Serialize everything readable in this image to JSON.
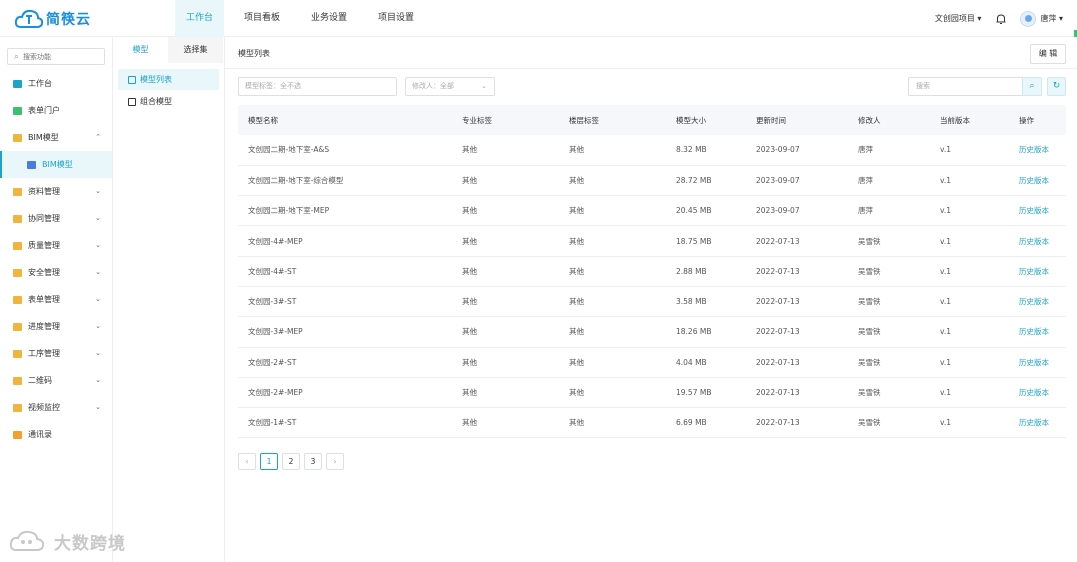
{
  "app": {
    "name": "简筷云"
  },
  "topnav": [
    {
      "label": "工作台",
      "active": true
    },
    {
      "label": "项目看板",
      "active": false
    },
    {
      "label": "业务设置",
      "active": false
    },
    {
      "label": "项目设置",
      "active": false
    }
  ],
  "header": {
    "project": "文创园项目 ▾",
    "user": "唐萍 ▾"
  },
  "sidebar": {
    "search_placeholder": "搜索功能",
    "items": [
      {
        "label": "工作台",
        "icon": "dashboard-icon"
      },
      {
        "label": "表单门户",
        "icon": "form-portal-icon"
      },
      {
        "label": "BIM模型",
        "icon": "folder-icon",
        "chev": "⌃"
      },
      {
        "label": "BIM模型",
        "icon": "bim-icon"
      },
      {
        "label": "资料管理",
        "icon": "folder-icon",
        "chev": "⌄"
      },
      {
        "label": "协同管理",
        "icon": "folder-icon",
        "chev": "⌄"
      },
      {
        "label": "质量管理",
        "icon": "folder-icon",
        "chev": "⌄"
      },
      {
        "label": "安全管理",
        "icon": "folder-icon",
        "chev": "⌄"
      },
      {
        "label": "表单管理",
        "icon": "folder-icon",
        "chev": "⌄"
      },
      {
        "label": "进度管理",
        "icon": "folder-icon",
        "chev": "⌄"
      },
      {
        "label": "工序管理",
        "icon": "folder-icon",
        "chev": "⌄"
      },
      {
        "label": "二维码",
        "icon": "folder-icon",
        "chev": "⌄"
      },
      {
        "label": "视频监控",
        "icon": "folder-icon",
        "chev": "⌄"
      },
      {
        "label": "通讯录",
        "icon": "contacts-icon"
      }
    ]
  },
  "subpanel": {
    "tabs": [
      "模型",
      "选择集"
    ],
    "items": [
      "模型列表",
      "组合模型"
    ]
  },
  "main": {
    "title": "模型列表",
    "edit_label": "编 辑",
    "filter_tag": "模型标签：全不选",
    "filter_modifier": "修改人：全部",
    "search_placeholder": "搜索",
    "columns": [
      "模型名称",
      "专业标签",
      "楼层标签",
      "模型大小",
      "更新时间",
      "修改人",
      "当前版本",
      "操作"
    ],
    "rows": [
      [
        "文创园二期-地下室-A&S",
        "其他",
        "其他",
        "8.32 MB",
        "2023-09-07",
        "唐萍",
        "v.1",
        "历史版本"
      ],
      [
        "文创园二期-地下室-综合模型",
        "其他",
        "其他",
        "28.72 MB",
        "2023-09-07",
        "唐萍",
        "v.1",
        "历史版本"
      ],
      [
        "文创园二期-地下室-MEP",
        "其他",
        "其他",
        "20.45 MB",
        "2023-09-07",
        "唐萍",
        "v.1",
        "历史版本"
      ],
      [
        "文创园-4#-MEP",
        "其他",
        "其他",
        "18.75 MB",
        "2022-07-13",
        "吴雪铁",
        "v.1",
        "历史版本"
      ],
      [
        "文创园-4#-ST",
        "其他",
        "其他",
        "2.88 MB",
        "2022-07-13",
        "吴雪铁",
        "v.1",
        "历史版本"
      ],
      [
        "文创园-3#-ST",
        "其他",
        "其他",
        "3.58 MB",
        "2022-07-13",
        "吴雪铁",
        "v.1",
        "历史版本"
      ],
      [
        "文创园-3#-MEP",
        "其他",
        "其他",
        "18.26 MB",
        "2022-07-13",
        "吴雪铁",
        "v.1",
        "历史版本"
      ],
      [
        "文创园-2#-ST",
        "其他",
        "其他",
        "4.04 MB",
        "2022-07-13",
        "吴雪铁",
        "v.1",
        "历史版本"
      ],
      [
        "文创园-2#-MEP",
        "其他",
        "其他",
        "19.57 MB",
        "2022-07-13",
        "吴雪铁",
        "v.1",
        "历史版本"
      ],
      [
        "文创园-1#-ST",
        "其他",
        "其他",
        "6.69 MB",
        "2022-07-13",
        "吴雪铁",
        "v.1",
        "历史版本"
      ]
    ],
    "pager": {
      "prev": "‹",
      "pages": [
        "1",
        "2",
        "3"
      ],
      "next": "›"
    }
  },
  "watermark": "大数跨境",
  "colors": {
    "accent": "#1ba4c6",
    "folder": "#f0b53d"
  }
}
